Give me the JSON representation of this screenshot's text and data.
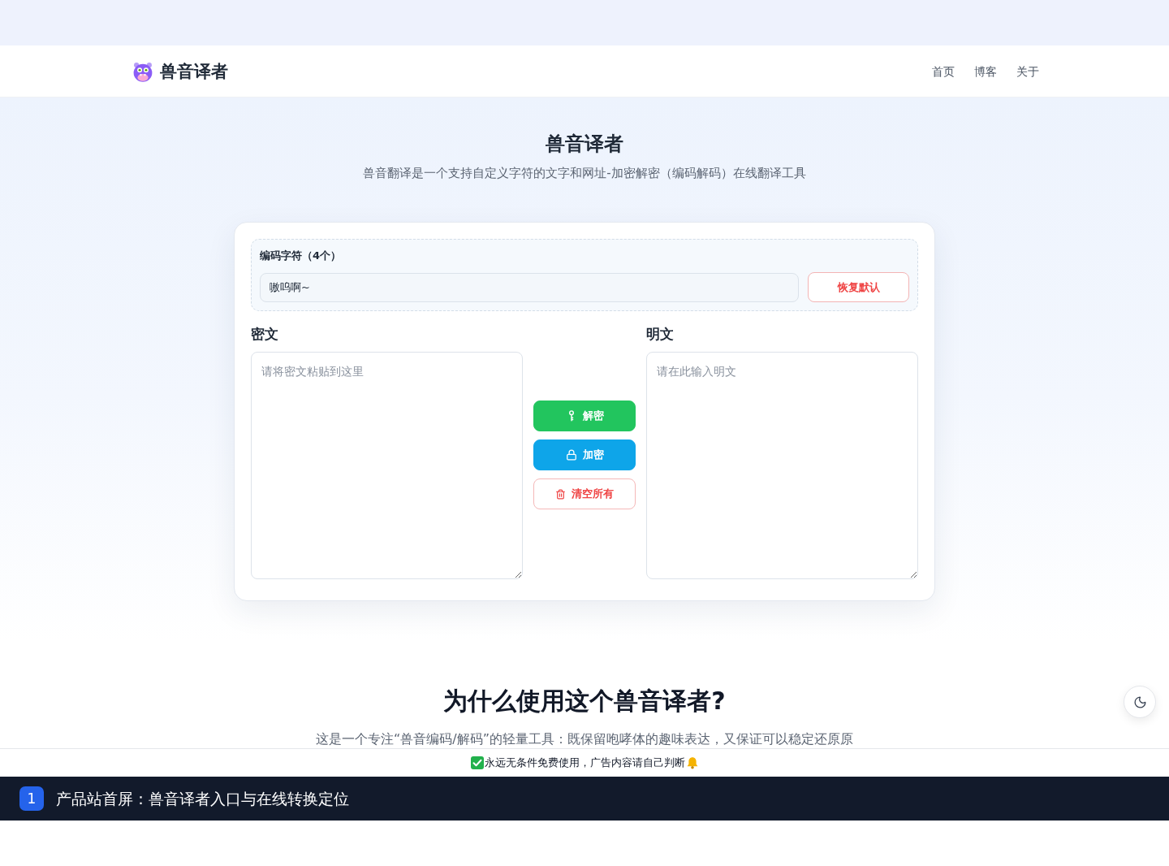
{
  "header": {
    "logo_text": "兽音译者",
    "nav": [
      {
        "label": "首页"
      },
      {
        "label": "博客"
      },
      {
        "label": "关于"
      }
    ]
  },
  "hero": {
    "title": "兽音译者",
    "subtitle": "兽音翻译是一个支持自定义字符的文字和网址-加密解密（编码解码）在线翻译工具"
  },
  "translator": {
    "charset": {
      "label": "编码字符（4个）",
      "value": "嗷呜啊~",
      "reset_button": "恢复默认"
    },
    "ciphertext": {
      "label": "密文",
      "placeholder": "请将密文粘贴到这里"
    },
    "plaintext": {
      "label": "明文",
      "placeholder": "请在此输入明文"
    },
    "actions": [
      {
        "kind": "decrypt",
        "label": "解密"
      },
      {
        "kind": "encrypt",
        "label": "加密"
      },
      {
        "kind": "clear",
        "label": "清空所有"
      }
    ]
  },
  "why": {
    "title": "为什么使用这个兽音译者?",
    "text": "这是一个专注“兽音编码/解码”的轻量工具：既保留咆哮体的趣味表达，又保证可以稳定还原原"
  },
  "notice_bar": {
    "text": "永远无条件免费使用，广告内容请自己判断"
  },
  "caption": {
    "number": "1",
    "text": "产品站首屏：兽音译者入口与在线转换定位"
  }
}
